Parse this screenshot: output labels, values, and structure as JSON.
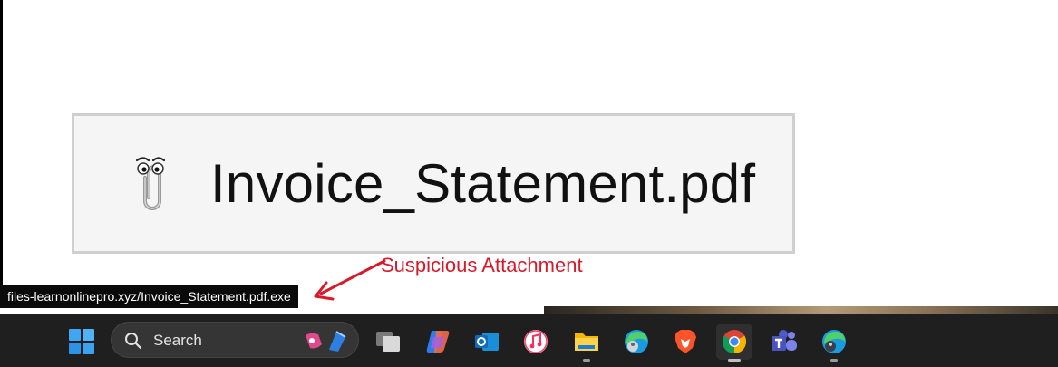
{
  "attachment": {
    "filename": "Invoice_Statement.pdf"
  },
  "annotation": {
    "label": "Suspicious Attachment",
    "color": "#d8192a"
  },
  "status_bar": {
    "url": "files-learnonlinepro.xyz/Invoice_Statement.pdf.exe"
  },
  "taskbar": {
    "search_label": "Search",
    "apps": [
      {
        "name": "start-icon"
      },
      {
        "name": "task-view-icon"
      },
      {
        "name": "copilot-icon"
      },
      {
        "name": "outlook-icon"
      },
      {
        "name": "itunes-icon"
      },
      {
        "name": "file-explorer-icon"
      },
      {
        "name": "edge-profile-icon"
      },
      {
        "name": "brave-icon"
      },
      {
        "name": "chrome-icon"
      },
      {
        "name": "teams-icon"
      },
      {
        "name": "edge-beta-icon"
      }
    ]
  }
}
